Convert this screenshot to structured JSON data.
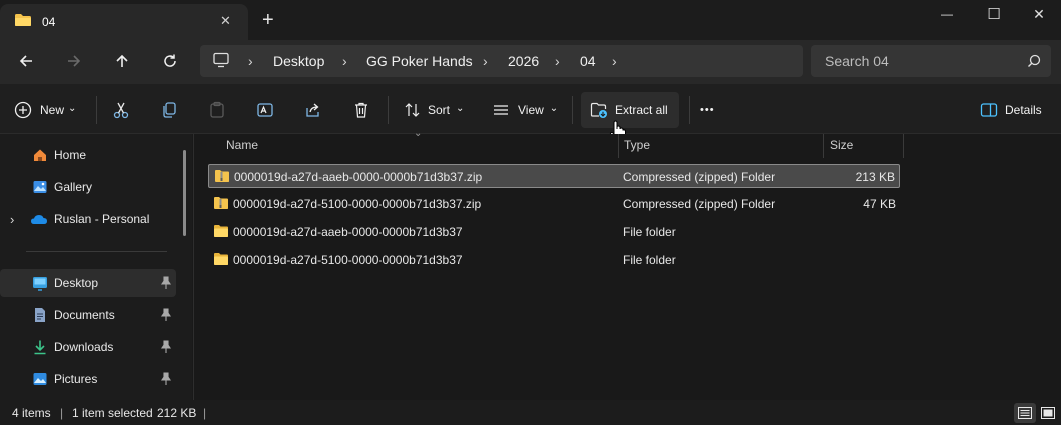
{
  "window": {
    "tab_title": "04",
    "new_tab_glyph": "+",
    "close_tab_glyph": "✕",
    "minimize_glyph": "—",
    "maximize_glyph": "☐",
    "close_glyph": "✕"
  },
  "address": {
    "crumbs": [
      "Desktop",
      "GG Poker Hands",
      "2026",
      "04"
    ],
    "chevron": "›",
    "search_placeholder": "Search 04"
  },
  "toolbar": {
    "new_label": "New",
    "sort_label": "Sort",
    "view_label": "View",
    "extract_label": "Extract all",
    "more_label": "•••",
    "details_label": "Details",
    "caret": "⌄"
  },
  "sidebar": {
    "quick": [
      {
        "label": "Home",
        "icon": "home-icon"
      },
      {
        "label": "Gallery",
        "icon": "gallery-icon"
      },
      {
        "label": "Ruslan - Personal",
        "icon": "cloud-icon",
        "expand": "›"
      }
    ],
    "pinned": [
      {
        "label": "Desktop",
        "icon": "desktop-folder-icon",
        "selected": true
      },
      {
        "label": "Documents",
        "icon": "documents-icon"
      },
      {
        "label": "Downloads",
        "icon": "downloads-icon"
      },
      {
        "label": "Pictures",
        "icon": "pictures-icon"
      }
    ]
  },
  "files": {
    "columns": {
      "name": "Name",
      "type": "Type",
      "size": "Size"
    },
    "rows": [
      {
        "name": "0000019d-a27d-aaeb-0000-0000b71d3b37.zip",
        "type": "Compressed (zipped) Folder",
        "size": "213 KB",
        "kind": "zip",
        "selected": true
      },
      {
        "name": "0000019d-a27d-5100-0000-0000b71d3b37.zip",
        "type": "Compressed (zipped) Folder",
        "size": "47 KB",
        "kind": "zip",
        "selected": false
      },
      {
        "name": "0000019d-a27d-aaeb-0000-0000b71d3b37",
        "type": "File folder",
        "size": "",
        "kind": "folder",
        "selected": false
      },
      {
        "name": "0000019d-a27d-5100-0000-0000b71d3b37",
        "type": "File folder",
        "size": "",
        "kind": "folder",
        "selected": false
      }
    ]
  },
  "status": {
    "items": "4 items",
    "divider": "|",
    "selected": "1 item selected",
    "selected_size": "212 KB"
  },
  "colors": {
    "accent": "#4cc2ff",
    "folder": "#f4c34d",
    "selection": "#4a4a4a"
  }
}
